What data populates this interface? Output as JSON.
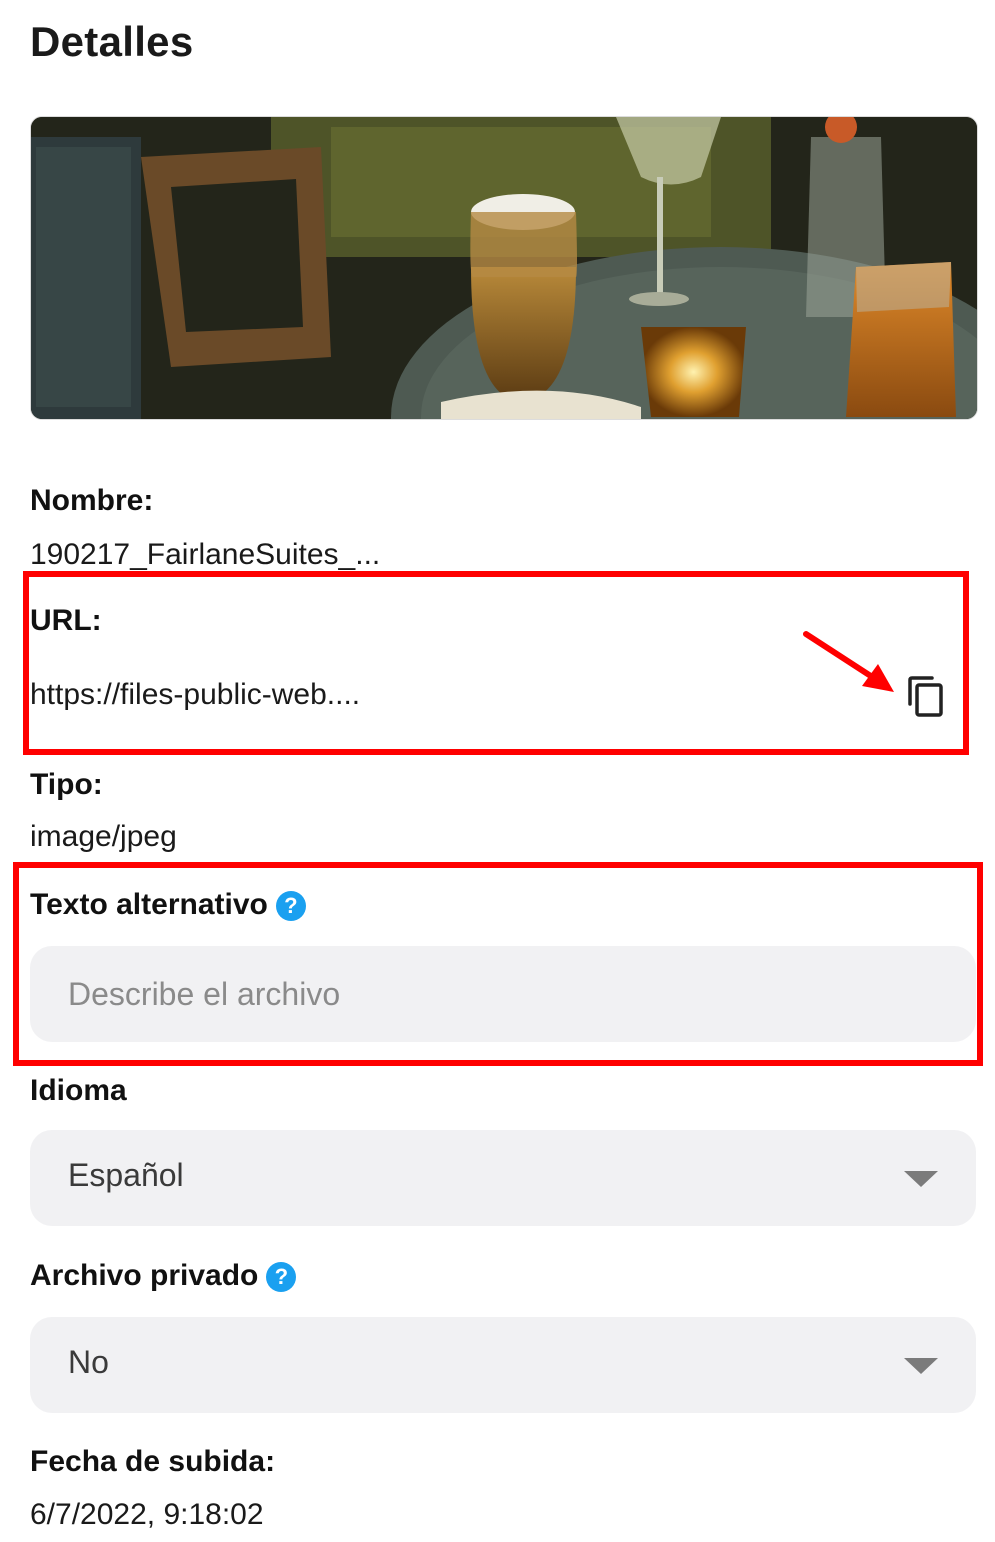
{
  "header": {
    "title": "Detalles"
  },
  "file": {
    "name_label": "Nombre:",
    "name_value": "190217_FairlaneSuites_...",
    "url_label": "URL:",
    "url_value": "https://files-public-web....",
    "copy_icon": "copy-icon",
    "type_label": "Tipo:",
    "type_value": "image/jpeg"
  },
  "alt_text": {
    "label": "Texto alternativo",
    "help": "?",
    "placeholder": "Describe el archivo",
    "value": ""
  },
  "language": {
    "label": "Idioma",
    "selected": "Español"
  },
  "private": {
    "label": "Archivo privado",
    "help": "?",
    "selected": "No"
  },
  "upload": {
    "label": "Fecha de subida:",
    "value": "6/7/2022, 9:18:02"
  },
  "annotations": {
    "highlight_color": "#ff0000",
    "accent_color": "#1aa0f0"
  }
}
